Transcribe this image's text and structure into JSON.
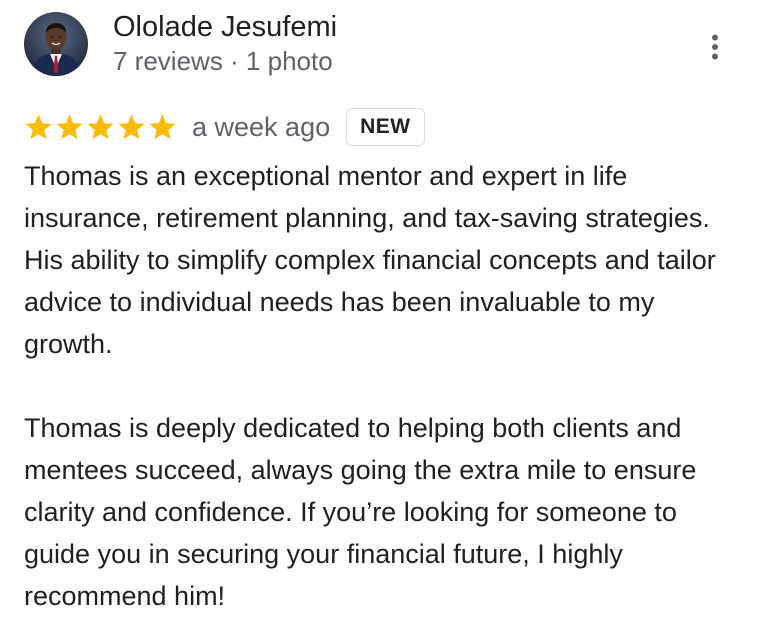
{
  "review": {
    "author": {
      "name": "Ololade Jesufemi",
      "meta": "7 reviews · 1 photo",
      "avatar_icon": "profile-photo"
    },
    "rating": {
      "stars": 5,
      "max_stars": 5,
      "star_color": "#fbbc04"
    },
    "time_ago": "a week ago",
    "badge": "NEW",
    "more_icon": "more-vert-icon",
    "text": {
      "paragraph_1": "Thomas is an exceptional mentor and expert in life insurance, retirement planning, and tax-saving strategies. His ability to simplify complex financial concepts and tailor advice to individual needs has been invaluable to my growth.",
      "paragraph_2": "Thomas is deeply dedicated to helping both clients and mentees succeed, always going the extra mile to ensure clarity and confidence. If you’re looking for someone to guide you in securing your financial future, I highly recommend him!"
    }
  }
}
